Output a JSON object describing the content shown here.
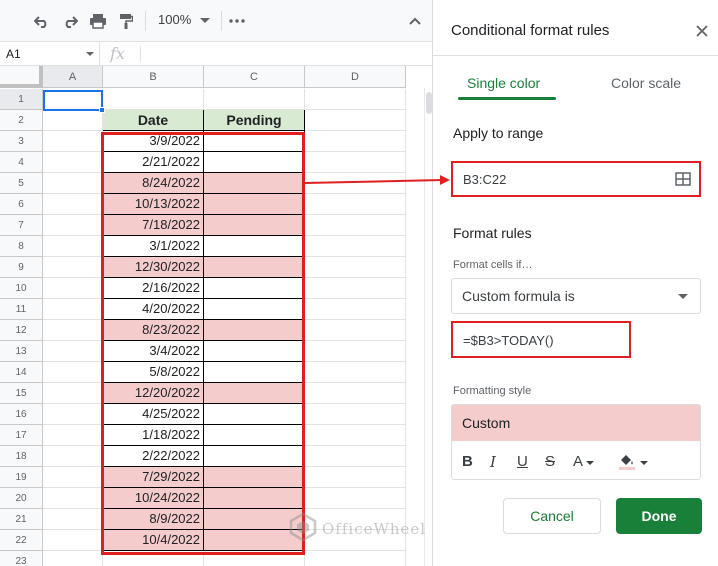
{
  "toolbar": {
    "zoom": "100%",
    "icons": [
      "undo-icon",
      "redo-icon",
      "print-icon",
      "paint-format-icon",
      "more-icon",
      "collapse-icon"
    ]
  },
  "formula_bar": {
    "name_box": "A1",
    "fx": "fx"
  },
  "grid": {
    "columns": [
      "A",
      "B",
      "C",
      "D"
    ],
    "rows": [
      "1",
      "2",
      "3",
      "4",
      "5",
      "6",
      "7",
      "8",
      "9",
      "10",
      "11",
      "12",
      "13",
      "14",
      "15",
      "16",
      "17",
      "18",
      "19",
      "20",
      "21",
      "22",
      "23"
    ],
    "table_header": {
      "date": "Date",
      "pending": "Pending"
    },
    "dates": [
      {
        "value": "3/9/2022",
        "highlight": false
      },
      {
        "value": "2/21/2022",
        "highlight": false
      },
      {
        "value": "8/24/2022",
        "highlight": true
      },
      {
        "value": "10/13/2022",
        "highlight": true
      },
      {
        "value": "7/18/2022",
        "highlight": true
      },
      {
        "value": "3/1/2022",
        "highlight": false
      },
      {
        "value": "12/30/2022",
        "highlight": true
      },
      {
        "value": "2/16/2022",
        "highlight": false
      },
      {
        "value": "4/20/2022",
        "highlight": false
      },
      {
        "value": "8/23/2022",
        "highlight": true
      },
      {
        "value": "3/4/2022",
        "highlight": false
      },
      {
        "value": "5/8/2022",
        "highlight": false
      },
      {
        "value": "12/20/2022",
        "highlight": true
      },
      {
        "value": "4/25/2022",
        "highlight": false
      },
      {
        "value": "1/18/2022",
        "highlight": false
      },
      {
        "value": "2/22/2022",
        "highlight": false
      },
      {
        "value": "7/29/2022",
        "highlight": true
      },
      {
        "value": "10/24/2022",
        "highlight": true
      },
      {
        "value": "8/9/2022",
        "highlight": true
      },
      {
        "value": "10/4/2022",
        "highlight": true
      }
    ],
    "highlight_color": "#f4cccc",
    "header_color": "#d9ead3"
  },
  "panel": {
    "title": "Conditional format rules",
    "tabs": {
      "single": "Single color",
      "scale": "Color scale"
    },
    "apply_label": "Apply to range",
    "range_value": "B3:C22",
    "format_rules_label": "Format rules",
    "format_cells_if_label": "Format cells if…",
    "condition": "Custom formula is",
    "formula": "=$B3>TODAY()",
    "formatting_style_label": "Formatting style",
    "style_name": "Custom",
    "style_tools": {
      "bold": "B",
      "italic": "I",
      "underline": "U",
      "strike": "S",
      "text_color": "A"
    },
    "cancel": "Cancel",
    "done": "Done",
    "accent": "#188038",
    "annotation_color": "#e02020"
  },
  "watermark": "OfficeWheel"
}
